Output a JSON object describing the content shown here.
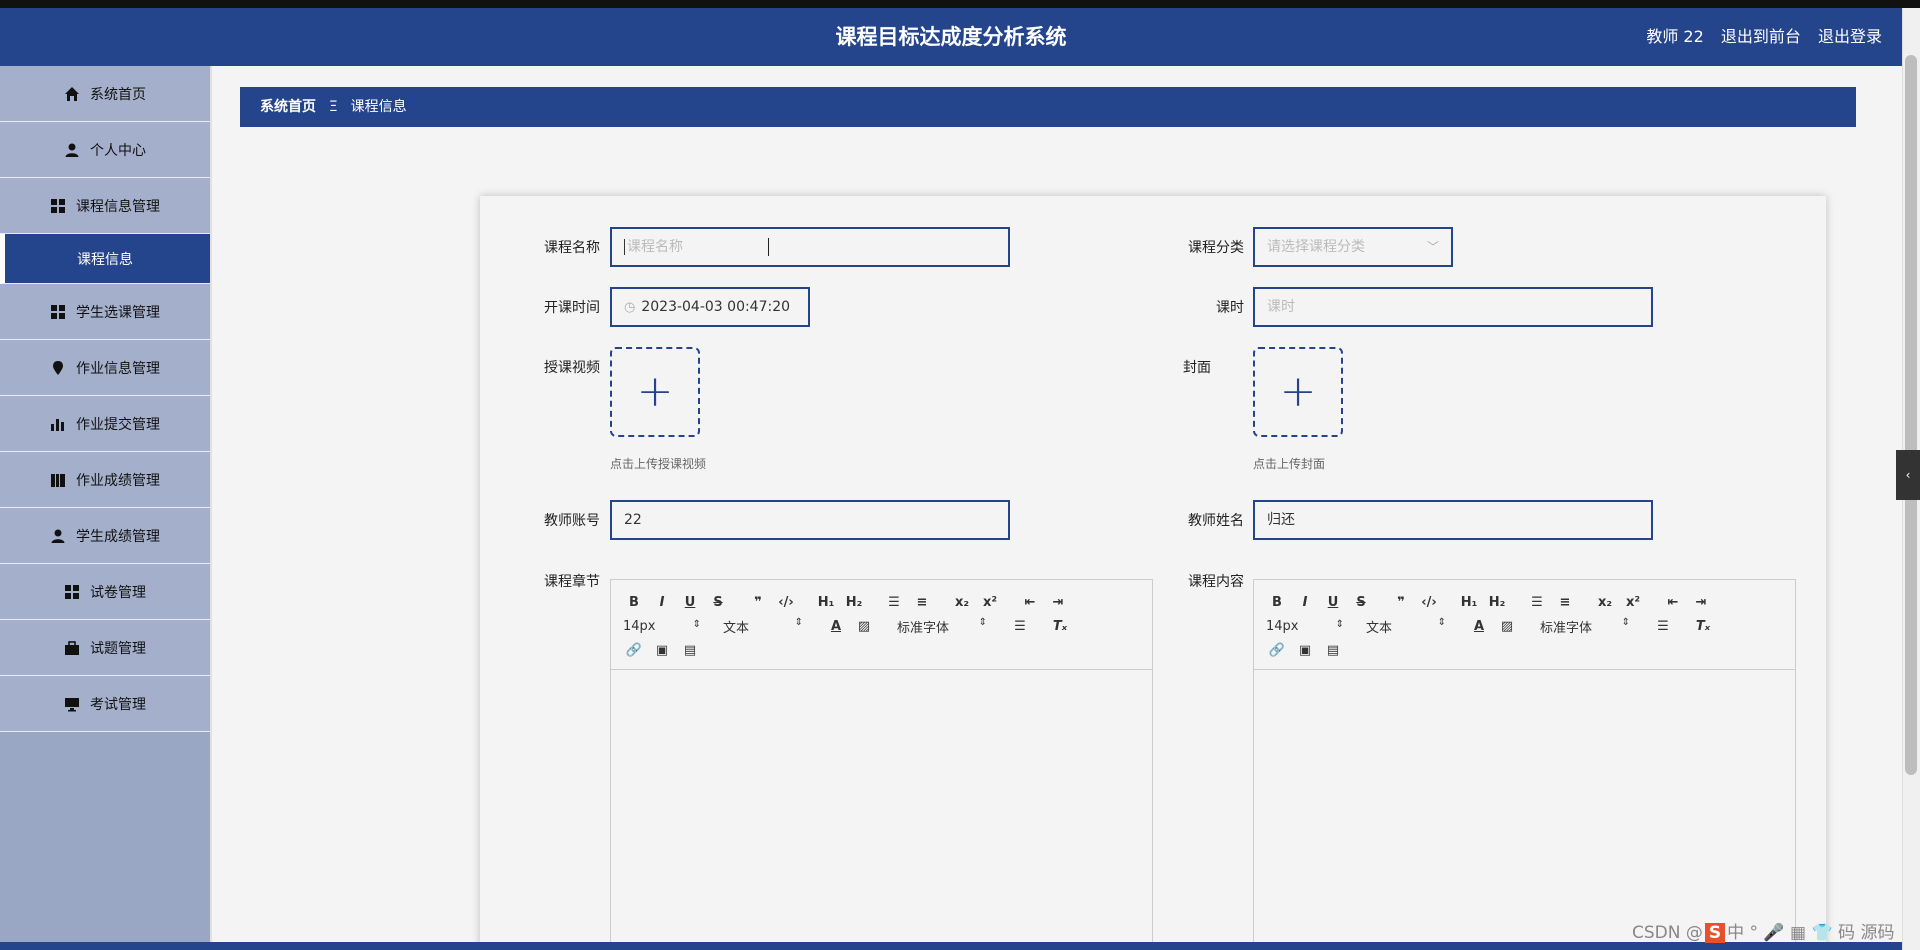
{
  "header": {
    "title": "课程目标达成度分析系统",
    "user": "教师 22",
    "back_to_front": "退出到前台",
    "logout": "退出登录"
  },
  "sidebar": {
    "items": [
      {
        "label": "系统首页",
        "icon": "home-icon"
      },
      {
        "label": "个人中心",
        "icon": "user-icon"
      },
      {
        "label": "课程信息管理",
        "icon": "grid-icon"
      },
      {
        "label": "课程信息",
        "icon": "",
        "active": true
      },
      {
        "label": "学生选课管理",
        "icon": "grid-icon"
      },
      {
        "label": "作业信息管理",
        "icon": "pin-icon"
      },
      {
        "label": "作业提交管理",
        "icon": "bar-chart-icon"
      },
      {
        "label": "作业成绩管理",
        "icon": "book-icon"
      },
      {
        "label": "学生成绩管理",
        "icon": "user-icon"
      },
      {
        "label": "试卷管理",
        "icon": "grid-icon"
      },
      {
        "label": "试题管理",
        "icon": "briefcase-icon"
      },
      {
        "label": "考试管理",
        "icon": "monitor-icon"
      }
    ]
  },
  "breadcrumb": {
    "home": "系统首页",
    "sep": "Ξ",
    "current": "课程信息"
  },
  "form": {
    "course_name_label": "课程名称",
    "course_name_placeholder": "课程名称",
    "course_category_label": "课程分类",
    "course_category_placeholder": "请选择课程分类",
    "start_time_label": "开课时间",
    "start_time_value": "2023-04-03 00:47:20",
    "hours_label": "课时",
    "hours_placeholder": "课时",
    "video_label": "授课视频",
    "video_hint": "点击上传授课视频",
    "cover_label": "封面",
    "cover_hint": "点击上传封面",
    "teacher_account_label": "教师账号",
    "teacher_account_value": "22",
    "teacher_name_label": "教师姓名",
    "teacher_name_value": "归还",
    "chapter_label": "课程章节",
    "content_label": "课程内容"
  },
  "editor": {
    "font_size": "14px",
    "block_format": "文本",
    "font_family": "标准字体"
  },
  "watermark": {
    "prefix": "CSDN @",
    "logo": "S",
    "rest": "中 ° 🎤 ▦ 👕 码 源码"
  },
  "colors": {
    "brand": "#24448c",
    "sidebar": "#a4b0cb"
  }
}
